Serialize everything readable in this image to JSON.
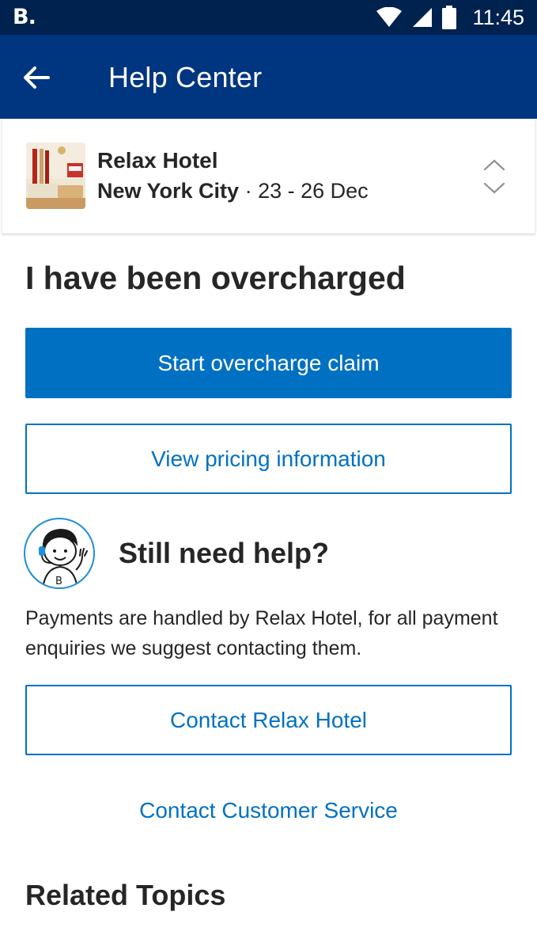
{
  "status_bar": {
    "logo": "B.",
    "time": "11:45",
    "icons": [
      "wifi-icon",
      "signal-icon",
      "battery-icon"
    ]
  },
  "app_bar": {
    "title": "Help Center",
    "back_icon": "arrow-left-icon"
  },
  "booking": {
    "hotel_name": "Relax Hotel",
    "city": "New York City",
    "separator": " · ",
    "dates": "23 - 26 Dec",
    "switch_icon": "chevron-up-down-icon"
  },
  "main": {
    "title": "I have been overcharged",
    "start_claim_label": "Start overcharge claim",
    "pricing_label": "View pricing information"
  },
  "help": {
    "heading": "Still need help?",
    "text": "Payments are handled by Relax Hotel, for all payment enquiries we suggest contacting them.",
    "contact_hotel_label": "Contact Relax Hotel",
    "contact_cs_label": "Contact Customer Service"
  },
  "related": {
    "title": "Related Topics"
  },
  "colors": {
    "status_bar": "#00224f",
    "app_bar": "#003580",
    "primary": "#0071c2",
    "text": "#262626"
  }
}
